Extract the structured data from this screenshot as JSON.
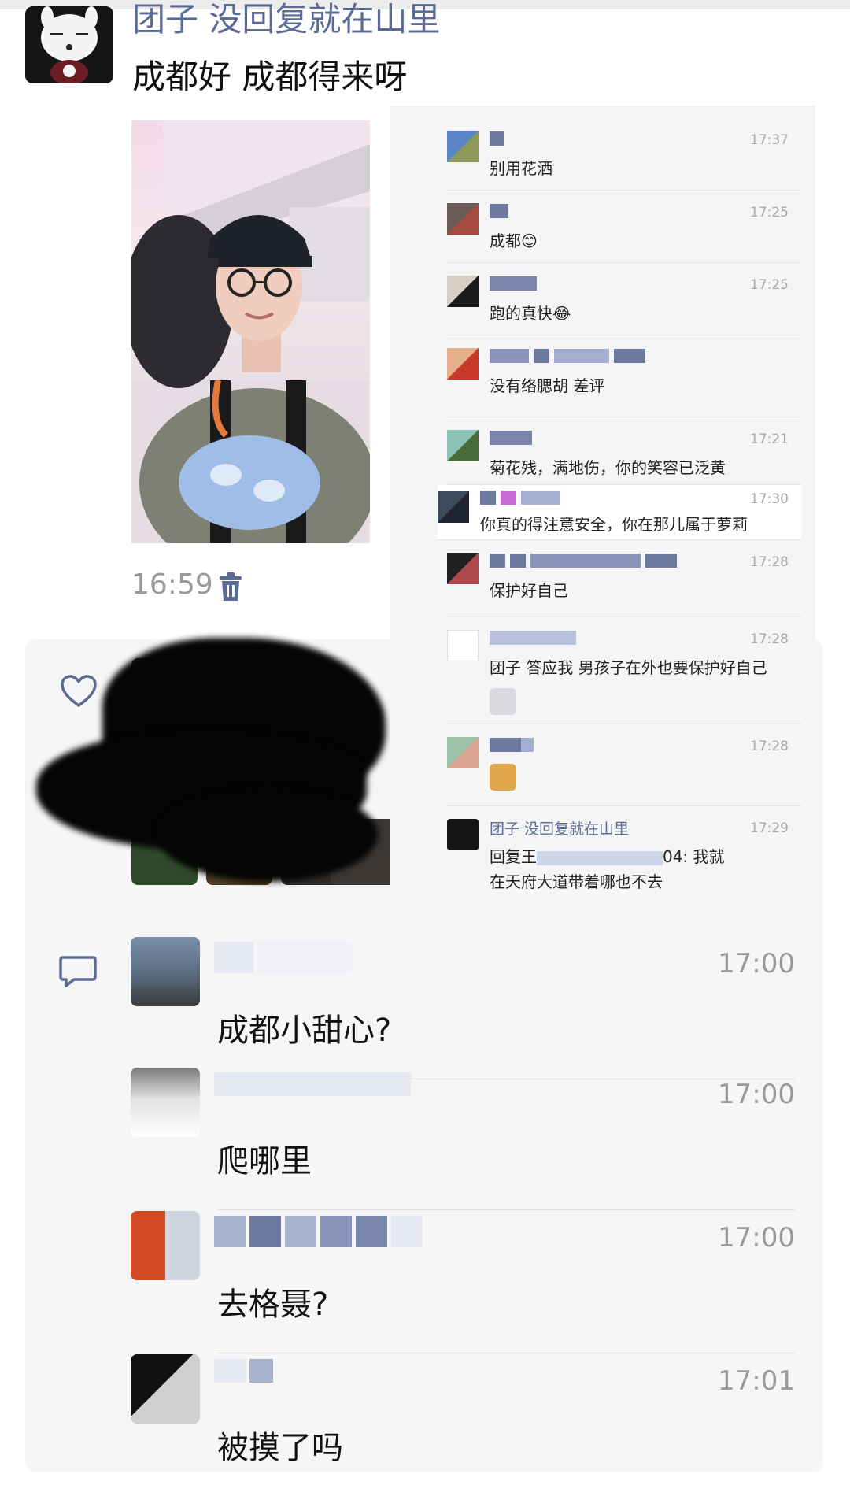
{
  "post": {
    "author": "团子 没回复就在山里",
    "text": "成都好  成都得来呀",
    "time": "16:59"
  },
  "overlay_comments": [
    {
      "name": "",
      "time": "17:37",
      "text": "别用花洒"
    },
    {
      "name": "",
      "time": "17:25",
      "text": "成都😊"
    },
    {
      "name": "",
      "time": "17:25",
      "text": "跑的真快😂"
    },
    {
      "name": "",
      "time": "",
      "text": "没有络腮胡 差评"
    },
    {
      "name": "",
      "time": "17:21",
      "text": "菊花残，满地伤，你的笑容已泛黄"
    },
    {
      "name": "",
      "time": "17:30",
      "text": "你真的得注意安全，你在那儿属于萝莉"
    },
    {
      "name": "",
      "time": "17:28",
      "text": "保护好自己"
    },
    {
      "name": "",
      "time": "17:28",
      "text": "团子 答应我 男孩子在外也要保护好自己"
    },
    {
      "name": "",
      "time": "17:28",
      "text": ""
    },
    {
      "name": "团子 没回复就在山里",
      "time": "17:29",
      "text": "回复王",
      "reply_suffix": "04: 我就",
      "text2": "在天府大道带着哪也不去"
    }
  ],
  "comments": [
    {
      "time": "17:00",
      "text": "成都小甜心?"
    },
    {
      "time": "17:00",
      "text": "爬哪里"
    },
    {
      "time": "17:00",
      "text": "去格聂?"
    },
    {
      "time": "17:01",
      "text": "被摸了吗"
    }
  ],
  "colors": {
    "name_blue": "#5b6b95",
    "bg_gray": "#f6f6f6",
    "time_gray": "#9a9a9a"
  },
  "icons": [
    "heart-icon",
    "comment-icon",
    "delete-icon"
  ]
}
